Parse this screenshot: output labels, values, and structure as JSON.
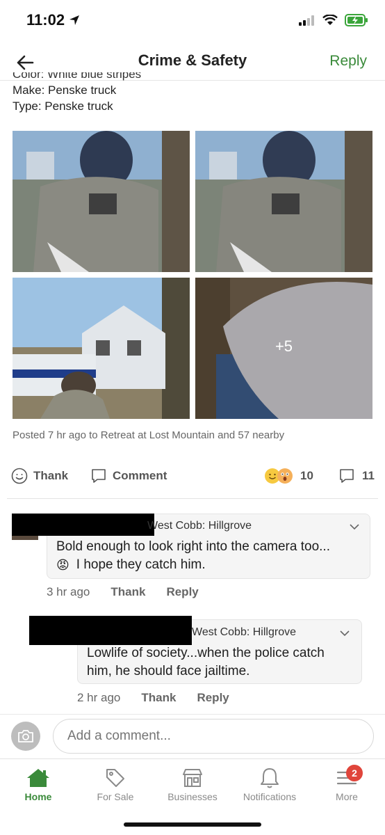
{
  "status_bar": {
    "time": "11:02"
  },
  "nav": {
    "title": "Crime & Safety",
    "reply_label": "Reply"
  },
  "post": {
    "cut_line": "Color: White blue stripes",
    "make": "Make: Penske truck",
    "type": "Type: Penske truck",
    "more_photos": "+5",
    "posted": "Posted 7 hr ago to Retreat at Lost Mountain and 57 nearby"
  },
  "actions": {
    "thank_label": "Thank",
    "comment_label": "Comment",
    "reaction_count": "10",
    "comment_count": "11"
  },
  "comments": [
    {
      "neighborhood": "West Cobb: Hillgrove",
      "text_line1": "Bold enough to look right into the camera too...",
      "text_line2": "I hope they catch him.",
      "emoji": "😡",
      "time": "3 hr ago",
      "thank": "Thank",
      "reply": "Reply"
    },
    {
      "neighborhood": "West Cobb: Hillgrove",
      "text_line1": "Lowlife of society...when the police catch",
      "text_line2": "him, he should face jailtime.",
      "time": "2 hr ago",
      "thank": "Thank",
      "reply": "Reply"
    }
  ],
  "composer": {
    "placeholder": "Add a comment..."
  },
  "tabs": [
    {
      "label": "Home",
      "icon": "home-icon"
    },
    {
      "label": "For Sale",
      "icon": "tag-icon"
    },
    {
      "label": "Businesses",
      "icon": "storefront-icon"
    },
    {
      "label": "Notifications",
      "icon": "bell-icon"
    },
    {
      "label": "More",
      "icon": "menu-icon",
      "badge": "2"
    }
  ],
  "colors": {
    "accent": "#3a8a3a",
    "badge": "#e0453b"
  }
}
